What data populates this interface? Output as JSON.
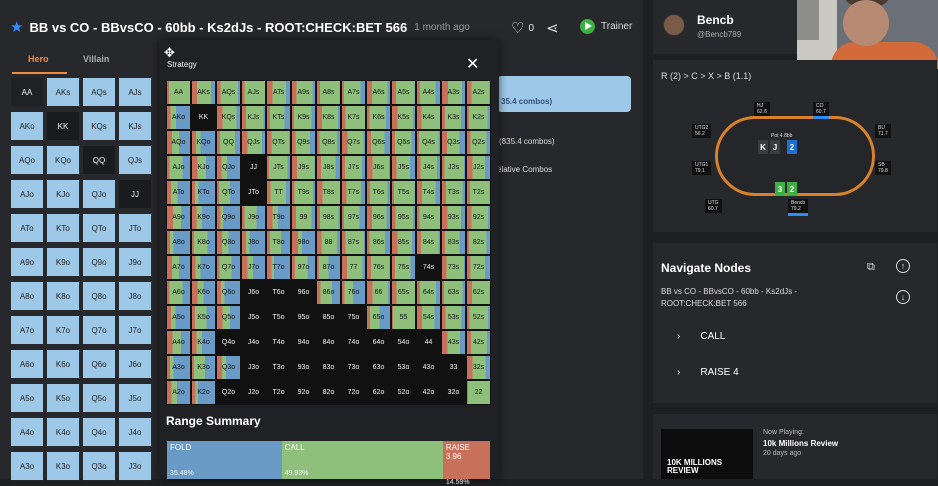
{
  "header": {
    "title": "BB vs CO - BBvsCO - 60bb - Ks2dJs - ROOT:CHECK:BET 566",
    "ago": "1 month ago",
    "likes": "0",
    "trainer_label": "Trainer"
  },
  "tabs": {
    "hero": "Hero",
    "villain": "Villain"
  },
  "background_matrix": {
    "rows": [
      [
        "AA",
        "AKs",
        "AQs",
        "AJs"
      ],
      [
        "AKo",
        "KK",
        "KQs",
        "KJs"
      ],
      [
        "AQo",
        "KQo",
        "QQ",
        "QJs"
      ],
      [
        "AJo",
        "KJo",
        "QJo",
        "JJ"
      ],
      [
        "ATo",
        "KTo",
        "QTo",
        "JTo"
      ],
      [
        "A9o",
        "K9o",
        "Q9o",
        "J9o"
      ],
      [
        "A8o",
        "K8o",
        "Q8o",
        "J8o"
      ],
      [
        "A7o",
        "K7o",
        "Q7o",
        "J7o"
      ],
      [
        "A6o",
        "K6o",
        "Q6o",
        "J6o"
      ],
      [
        "A5o",
        "K5o",
        "Q5o",
        "J5o"
      ],
      [
        "A4o",
        "K4o",
        "Q4o",
        "J4o"
      ],
      [
        "A3o",
        "K3o",
        "Q3o",
        "J3o"
      ]
    ]
  },
  "side_panel": {
    "selection_text": "35.4 combos)",
    "combos_text": "(835.4 combos)",
    "relative_label": "elative Combos"
  },
  "modal": {
    "title": "Strategy",
    "range_summary_title": "Range Summary",
    "summary": [
      {
        "label": "FOLD",
        "pct": "35.48%",
        "value": 35.48,
        "color": "#6a9bc6"
      },
      {
        "label": "CALL",
        "pct": "49.93%",
        "value": 49.93,
        "color": "#8ec07c"
      },
      {
        "label": "RAISE 3.96",
        "pct": "14.59%",
        "value": 14.59,
        "color": "#c9705a"
      }
    ]
  },
  "grid": {
    "ranks": [
      "A",
      "K",
      "Q",
      "J",
      "T",
      "9",
      "8",
      "7",
      "6",
      "5",
      "4",
      "3",
      "2"
    ],
    "colors": {
      "fold": "#6a9bc6",
      "call": "#8ec07c",
      "raise": "#c9705a"
    },
    "dark_cells": [
      [
        1,
        1
      ],
      [
        3,
        3
      ],
      [
        4,
        3
      ],
      [
        7,
        10
      ],
      [
        8,
        3
      ],
      [
        8,
        4
      ],
      [
        8,
        5
      ],
      [
        9,
        3
      ],
      [
        9,
        4
      ],
      [
        9,
        5
      ],
      [
        9,
        6
      ],
      [
        9,
        7
      ],
      [
        10,
        2
      ],
      [
        10,
        3
      ],
      [
        10,
        4
      ],
      [
        10,
        5
      ],
      [
        10,
        6
      ],
      [
        10,
        7
      ],
      [
        10,
        8
      ],
      [
        10,
        9
      ],
      [
        10,
        10
      ],
      [
        11,
        3
      ],
      [
        11,
        4
      ],
      [
        11,
        5
      ],
      [
        11,
        6
      ],
      [
        11,
        7
      ],
      [
        11,
        8
      ],
      [
        11,
        9
      ],
      [
        11,
        10
      ],
      [
        11,
        11
      ],
      [
        12,
        2
      ],
      [
        12,
        3
      ],
      [
        12,
        4
      ],
      [
        12,
        5
      ],
      [
        12,
        6
      ],
      [
        12,
        7
      ],
      [
        12,
        8
      ],
      [
        12,
        9
      ],
      [
        12,
        10
      ],
      [
        12,
        11
      ]
    ]
  },
  "profile": {
    "name": "Bencb",
    "handle": "@Bencb789"
  },
  "table": {
    "action_line": "R (2) > C > X > B (1.1)",
    "seats": [
      {
        "name": "HJ",
        "stack": "62.6"
      },
      {
        "name": "CO",
        "stack": "60.7"
      },
      {
        "name": "UTG2",
        "stack": "56.2"
      },
      {
        "name": "BU",
        "stack": "71.7"
      },
      {
        "name": "UTG1",
        "stack": "79.1"
      },
      {
        "name": "SB",
        "stack": "79.8"
      },
      {
        "name": "UTG",
        "stack": "60.7"
      },
      {
        "name": "Bencb",
        "stack": "79.2"
      }
    ],
    "pot": "Pot 4.8bb",
    "board": [
      "K",
      "J",
      "2"
    ],
    "hole": [
      "3",
      "2"
    ]
  },
  "nav": {
    "title": "Navigate Nodes",
    "path": "BB vs CO - BBvsCO - 60bb - Ks2dJs - ROOT:CHECK:BET 566",
    "options": [
      "CALL",
      "RAISE 4"
    ]
  },
  "now_playing": {
    "label": "Now Playing:",
    "title": "10k Millions Review",
    "ago": "20 days ago",
    "thumb_text": "10K MILLIONS REVIEW"
  }
}
